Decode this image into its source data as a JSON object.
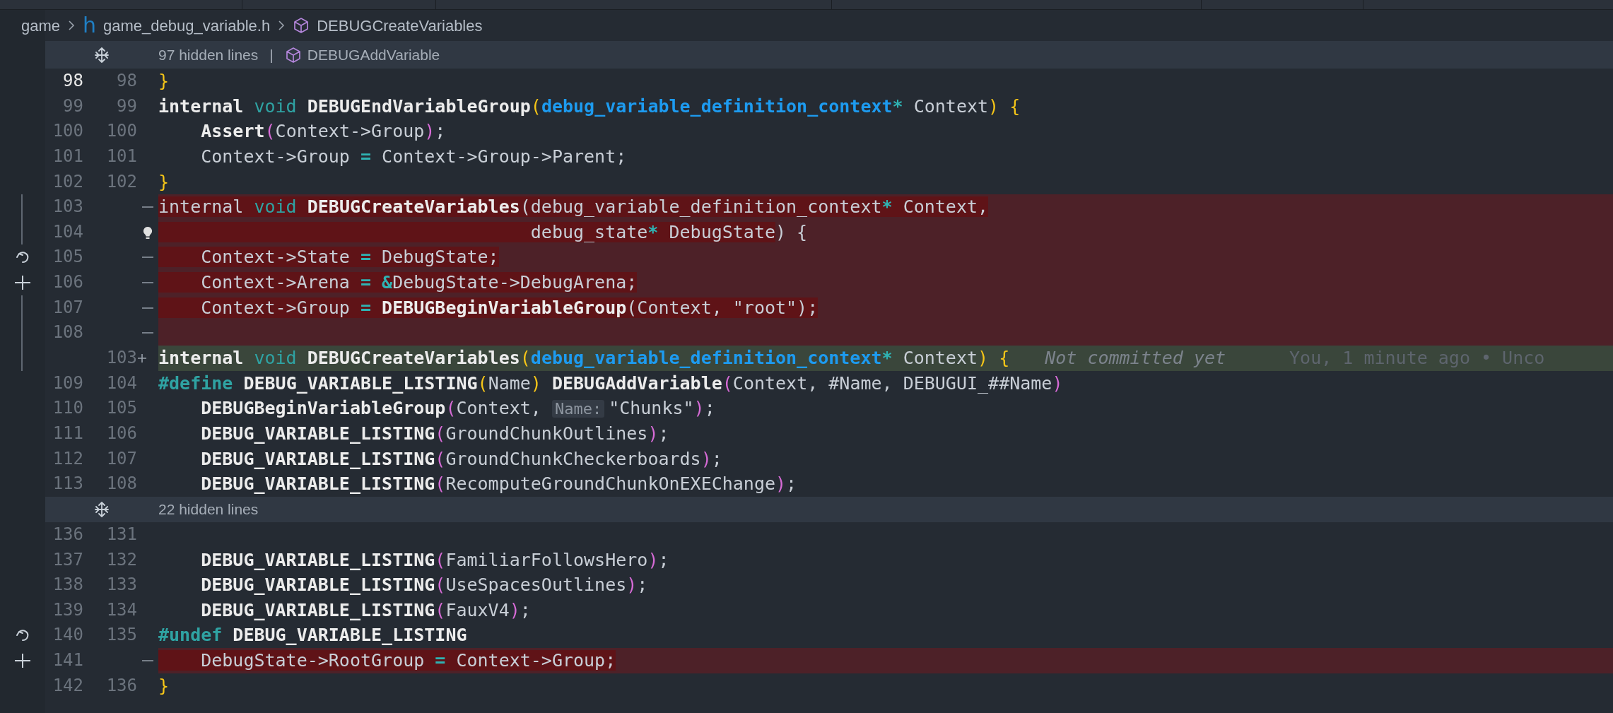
{
  "breadcrumb": [
    {
      "kind": "folder",
      "text": "game"
    },
    {
      "kind": "file",
      "glyph": "h",
      "text": "game_debug_variable.h"
    },
    {
      "kind": "symbol",
      "text": "DEBUGCreateVariables"
    }
  ],
  "rows": [
    {
      "kind": "fold",
      "text": "97 hidden lines",
      "separator": "|",
      "symbol": "DEBUGAddVariable"
    },
    {
      "kind": "context",
      "old": "98",
      "new": "98",
      "current": true,
      "tokens": [
        {
          "kind": "br1",
          "t": "}"
        }
      ]
    },
    {
      "kind": "context",
      "old": "99",
      "new": "99",
      "current": false,
      "tokens": [
        {
          "kind": "kw",
          "t": "internal "
        },
        {
          "kind": "tkw",
          "t": "void "
        },
        {
          "kind": "fn",
          "t": "DEBUGEndVariableGroup"
        },
        {
          "kind": "br1",
          "t": "("
        },
        {
          "kind": "type",
          "t": "debug_variable_definition_context"
        },
        {
          "kind": "op",
          "t": "*"
        },
        {
          "kind": "plain",
          "t": " Context"
        },
        {
          "kind": "br1",
          "t": ")"
        },
        {
          "kind": "br1",
          "t": " {"
        }
      ]
    },
    {
      "kind": "context",
      "old": "100",
      "new": "100",
      "current": false,
      "tokens": [
        {
          "kind": "fn",
          "t": "    Assert"
        },
        {
          "kind": "br2",
          "t": "("
        },
        {
          "kind": "plain",
          "t": "Context->Group"
        },
        {
          "kind": "br2",
          "t": ")"
        },
        {
          "kind": "plain",
          "t": ";"
        }
      ]
    },
    {
      "kind": "context",
      "old": "101",
      "new": "101",
      "current": false,
      "tokens": [
        {
          "kind": "plain",
          "t": "    Context->Group "
        },
        {
          "kind": "op",
          "t": "="
        },
        {
          "kind": "plain",
          "t": " Context->Group->Parent;"
        }
      ]
    },
    {
      "kind": "context",
      "old": "102",
      "new": "102",
      "current": false,
      "tokens": [
        {
          "kind": "br1",
          "t": "}"
        }
      ]
    },
    {
      "kind": "deleted",
      "old": "103",
      "current": false,
      "tokens": [
        {
          "kind": "plain",
          "t": "internal ",
          "changed": true
        },
        {
          "kind": "tkw",
          "t": "void ",
          "changed": true
        },
        {
          "kind": "fn",
          "t": "DEBUGCreateVariables",
          "changed": true
        },
        {
          "kind": "plain",
          "t": "(debug_variable_definition_context",
          "changed": true
        },
        {
          "kind": "op",
          "t": "*",
          "changed": true
        },
        {
          "kind": "plain",
          "t": " Context,",
          "changed": true
        }
      ]
    },
    {
      "kind": "deleted",
      "old": "104",
      "current": false,
      "lightbulb": true,
      "tokens": [
        {
          "kind": "plain",
          "t": "                                   debug_state",
          "changed": true
        },
        {
          "kind": "op",
          "t": "*",
          "changed": true
        },
        {
          "kind": "plain",
          "t": " DebugState",
          "changed": true
        },
        {
          "kind": "plain",
          "t": ") {",
          "changed": false
        }
      ]
    },
    {
      "kind": "deleted",
      "old": "105",
      "current": false,
      "tokens": [
        {
          "kind": "plain",
          "t": "    Context->State ",
          "changed": true
        },
        {
          "kind": "op",
          "t": "=",
          "changed": true
        },
        {
          "kind": "plain",
          "t": " DebugState;",
          "changed": true
        }
      ]
    },
    {
      "kind": "deleted",
      "old": "106",
      "current": false,
      "tokens": [
        {
          "kind": "plain",
          "t": "    Context->Arena ",
          "changed": true
        },
        {
          "kind": "op",
          "t": "= &",
          "changed": true
        },
        {
          "kind": "plain",
          "t": "DebugState->DebugArena;",
          "changed": true
        }
      ]
    },
    {
      "kind": "deleted",
      "old": "107",
      "current": false,
      "tokens": [
        {
          "kind": "plain",
          "t": "    Context->Group ",
          "changed": true
        },
        {
          "kind": "op",
          "t": "=",
          "changed": true
        },
        {
          "kind": "fn",
          "t": " DEBUGBeginVariableGroup",
          "changed": true
        },
        {
          "kind": "plain",
          "t": "(Context, \"root\");",
          "changed": true
        }
      ]
    },
    {
      "kind": "deleted",
      "old": "108",
      "current": false
    },
    {
      "kind": "added",
      "new": "103",
      "tokens": [
        {
          "kind": "kw",
          "t": "internal "
        },
        {
          "kind": "tkw",
          "t": "void "
        },
        {
          "kind": "fn",
          "t": "DEBUGCreateVariables"
        },
        {
          "kind": "br1",
          "t": "("
        },
        {
          "kind": "type",
          "t": "debug_variable_definition_context"
        },
        {
          "kind": "op",
          "t": "*"
        },
        {
          "kind": "plain",
          "t": " Context"
        },
        {
          "kind": "br1",
          "t": ")"
        },
        {
          "kind": "br1",
          "t": " {"
        }
      ],
      "blame": {
        "status": "Not committed yet",
        "detail": "You, 1 minute ago • Unco"
      }
    },
    {
      "kind": "context",
      "old": "109",
      "new": "104",
      "current": false,
      "tokens": [
        {
          "kind": "dir",
          "t": "#define "
        },
        {
          "kind": "fn",
          "t": "DEBUG_VARIABLE_LISTING"
        },
        {
          "kind": "br1",
          "t": "("
        },
        {
          "kind": "plain",
          "t": "Name"
        },
        {
          "kind": "br1",
          "t": ")"
        },
        {
          "kind": "fn",
          "t": " DEBUGAddVariable"
        },
        {
          "kind": "br2",
          "t": "("
        },
        {
          "kind": "plain",
          "t": "Context, #Name, DEBUGUI_##Name"
        },
        {
          "kind": "br2",
          "t": ")"
        }
      ]
    },
    {
      "kind": "context",
      "old": "110",
      "new": "105",
      "current": false,
      "tokens": [
        {
          "kind": "fn",
          "t": "    DEBUGBeginVariableGroup"
        },
        {
          "kind": "br2",
          "t": "("
        },
        {
          "kind": "plain",
          "t": "Context, "
        },
        {
          "kind": "hint",
          "t": "Name:"
        },
        {
          "kind": "plain",
          "t": "\"Chunks\""
        },
        {
          "kind": "br2",
          "t": ")"
        },
        {
          "kind": "plain",
          "t": ";"
        }
      ]
    },
    {
      "kind": "context",
      "old": "111",
      "new": "106",
      "current": false,
      "tokens": [
        {
          "kind": "fn",
          "t": "    DEBUG_VARIABLE_LISTING"
        },
        {
          "kind": "br2",
          "t": "("
        },
        {
          "kind": "plain",
          "t": "GroundChunkOutlines"
        },
        {
          "kind": "br2",
          "t": ")"
        },
        {
          "kind": "plain",
          "t": ";"
        }
      ]
    },
    {
      "kind": "context",
      "old": "112",
      "new": "107",
      "current": false,
      "tokens": [
        {
          "kind": "fn",
          "t": "    DEBUG_VARIABLE_LISTING"
        },
        {
          "kind": "br2",
          "t": "("
        },
        {
          "kind": "plain",
          "t": "GroundChunkCheckerboards"
        },
        {
          "kind": "br2",
          "t": ")"
        },
        {
          "kind": "plain",
          "t": ";"
        }
      ]
    },
    {
      "kind": "context",
      "old": "113",
      "new": "108",
      "current": false,
      "tokens": [
        {
          "kind": "fn",
          "t": "    DEBUG_VARIABLE_LISTING"
        },
        {
          "kind": "br2",
          "t": "("
        },
        {
          "kind": "plain",
          "t": "RecomputeGroundChunkOnEXEChange"
        },
        {
          "kind": "br2",
          "t": ")"
        },
        {
          "kind": "plain",
          "t": ";"
        }
      ]
    },
    {
      "kind": "fold",
      "text": "22 hidden lines"
    },
    {
      "kind": "context",
      "old": "136",
      "new": "131",
      "current": false
    },
    {
      "kind": "context",
      "old": "137",
      "new": "132",
      "current": false,
      "tokens": [
        {
          "kind": "fn",
          "t": "    DEBUG_VARIABLE_LISTING"
        },
        {
          "kind": "br2",
          "t": "("
        },
        {
          "kind": "plain",
          "t": "FamiliarFollowsHero"
        },
        {
          "kind": "br2",
          "t": ")"
        },
        {
          "kind": "plain",
          "t": ";"
        }
      ]
    },
    {
      "kind": "context",
      "old": "138",
      "new": "133",
      "current": false,
      "tokens": [
        {
          "kind": "fn",
          "t": "    DEBUG_VARIABLE_LISTING"
        },
        {
          "kind": "br2",
          "t": "("
        },
        {
          "kind": "plain",
          "t": "UseSpacesOutlines"
        },
        {
          "kind": "br2",
          "t": ")"
        },
        {
          "kind": "plain",
          "t": ";"
        }
      ]
    },
    {
      "kind": "context",
      "old": "139",
      "new": "134",
      "current": false,
      "tokens": [
        {
          "kind": "fn",
          "t": "    DEBUG_VARIABLE_LISTING"
        },
        {
          "kind": "br2",
          "t": "("
        },
        {
          "kind": "plain",
          "t": "FauxV4"
        },
        {
          "kind": "br2",
          "t": ")"
        },
        {
          "kind": "plain",
          "t": ";"
        }
      ]
    },
    {
      "kind": "context",
      "old": "140",
      "new": "135",
      "current": false,
      "tokens": [
        {
          "kind": "dir",
          "t": "#undef "
        },
        {
          "kind": "fn",
          "t": "DEBUG_VARIABLE_LISTING"
        }
      ]
    },
    {
      "kind": "deleted",
      "old": "141",
      "current": false,
      "tokens": [
        {
          "kind": "plain",
          "t": "    DebugState->RootGroup ",
          "changed": true
        },
        {
          "kind": "op",
          "t": "=",
          "changed": true
        },
        {
          "kind": "plain",
          "t": " Context->Group;",
          "changed": true
        }
      ]
    },
    {
      "kind": "context",
      "old": "142",
      "new": "136",
      "current": false,
      "tokens": [
        {
          "kind": "br1",
          "t": "}"
        }
      ]
    }
  ]
}
